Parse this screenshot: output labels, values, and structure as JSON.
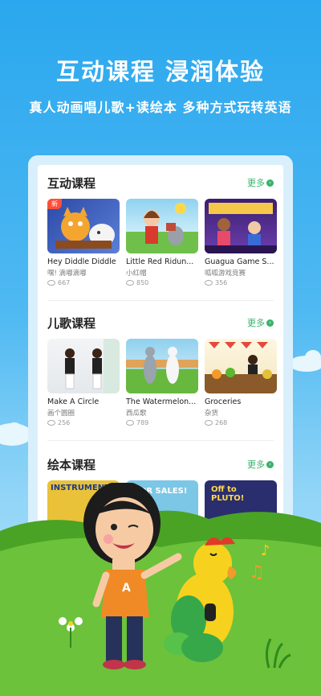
{
  "hero": {
    "title": "互动课程  浸润体验",
    "subtitle": "真人动画唱儿歌+读绘本  多种方式玩转英语"
  },
  "sections": [
    {
      "title": "互动课程",
      "more": "更多",
      "cards": [
        {
          "title": "Hey Diddle Diddle",
          "subtitle": "嘿! 滴嘟滴嘟",
          "views": "667",
          "badge": "新"
        },
        {
          "title": "Little Red Ridun...",
          "subtitle": "小红帽",
          "views": "850"
        },
        {
          "title": "Guagua Game S...",
          "subtitle": "呱呱游戏竞赛",
          "views": "356"
        }
      ]
    },
    {
      "title": "儿歌课程",
      "more": "更多",
      "cards": [
        {
          "title": "Make A Circle",
          "subtitle": "画个圆圈",
          "views": "256"
        },
        {
          "title": "The Watermelon...",
          "subtitle": "西瓜歌",
          "views": "789"
        },
        {
          "title": "Groceries",
          "subtitle": "杂货",
          "views": "268"
        }
      ]
    },
    {
      "title": "绘本课程",
      "more": "更多",
      "cards": [
        {
          "title": "INSTRUMENTS"
        },
        {
          "title": "FOR SALES!"
        },
        {
          "title": "Off to PLUTO!"
        }
      ]
    }
  ],
  "colors": {
    "sky": "#2aa7ee",
    "grass": "#5cb82e",
    "accent_green": "#36b36a",
    "new_badge": "#ff4e3a"
  }
}
